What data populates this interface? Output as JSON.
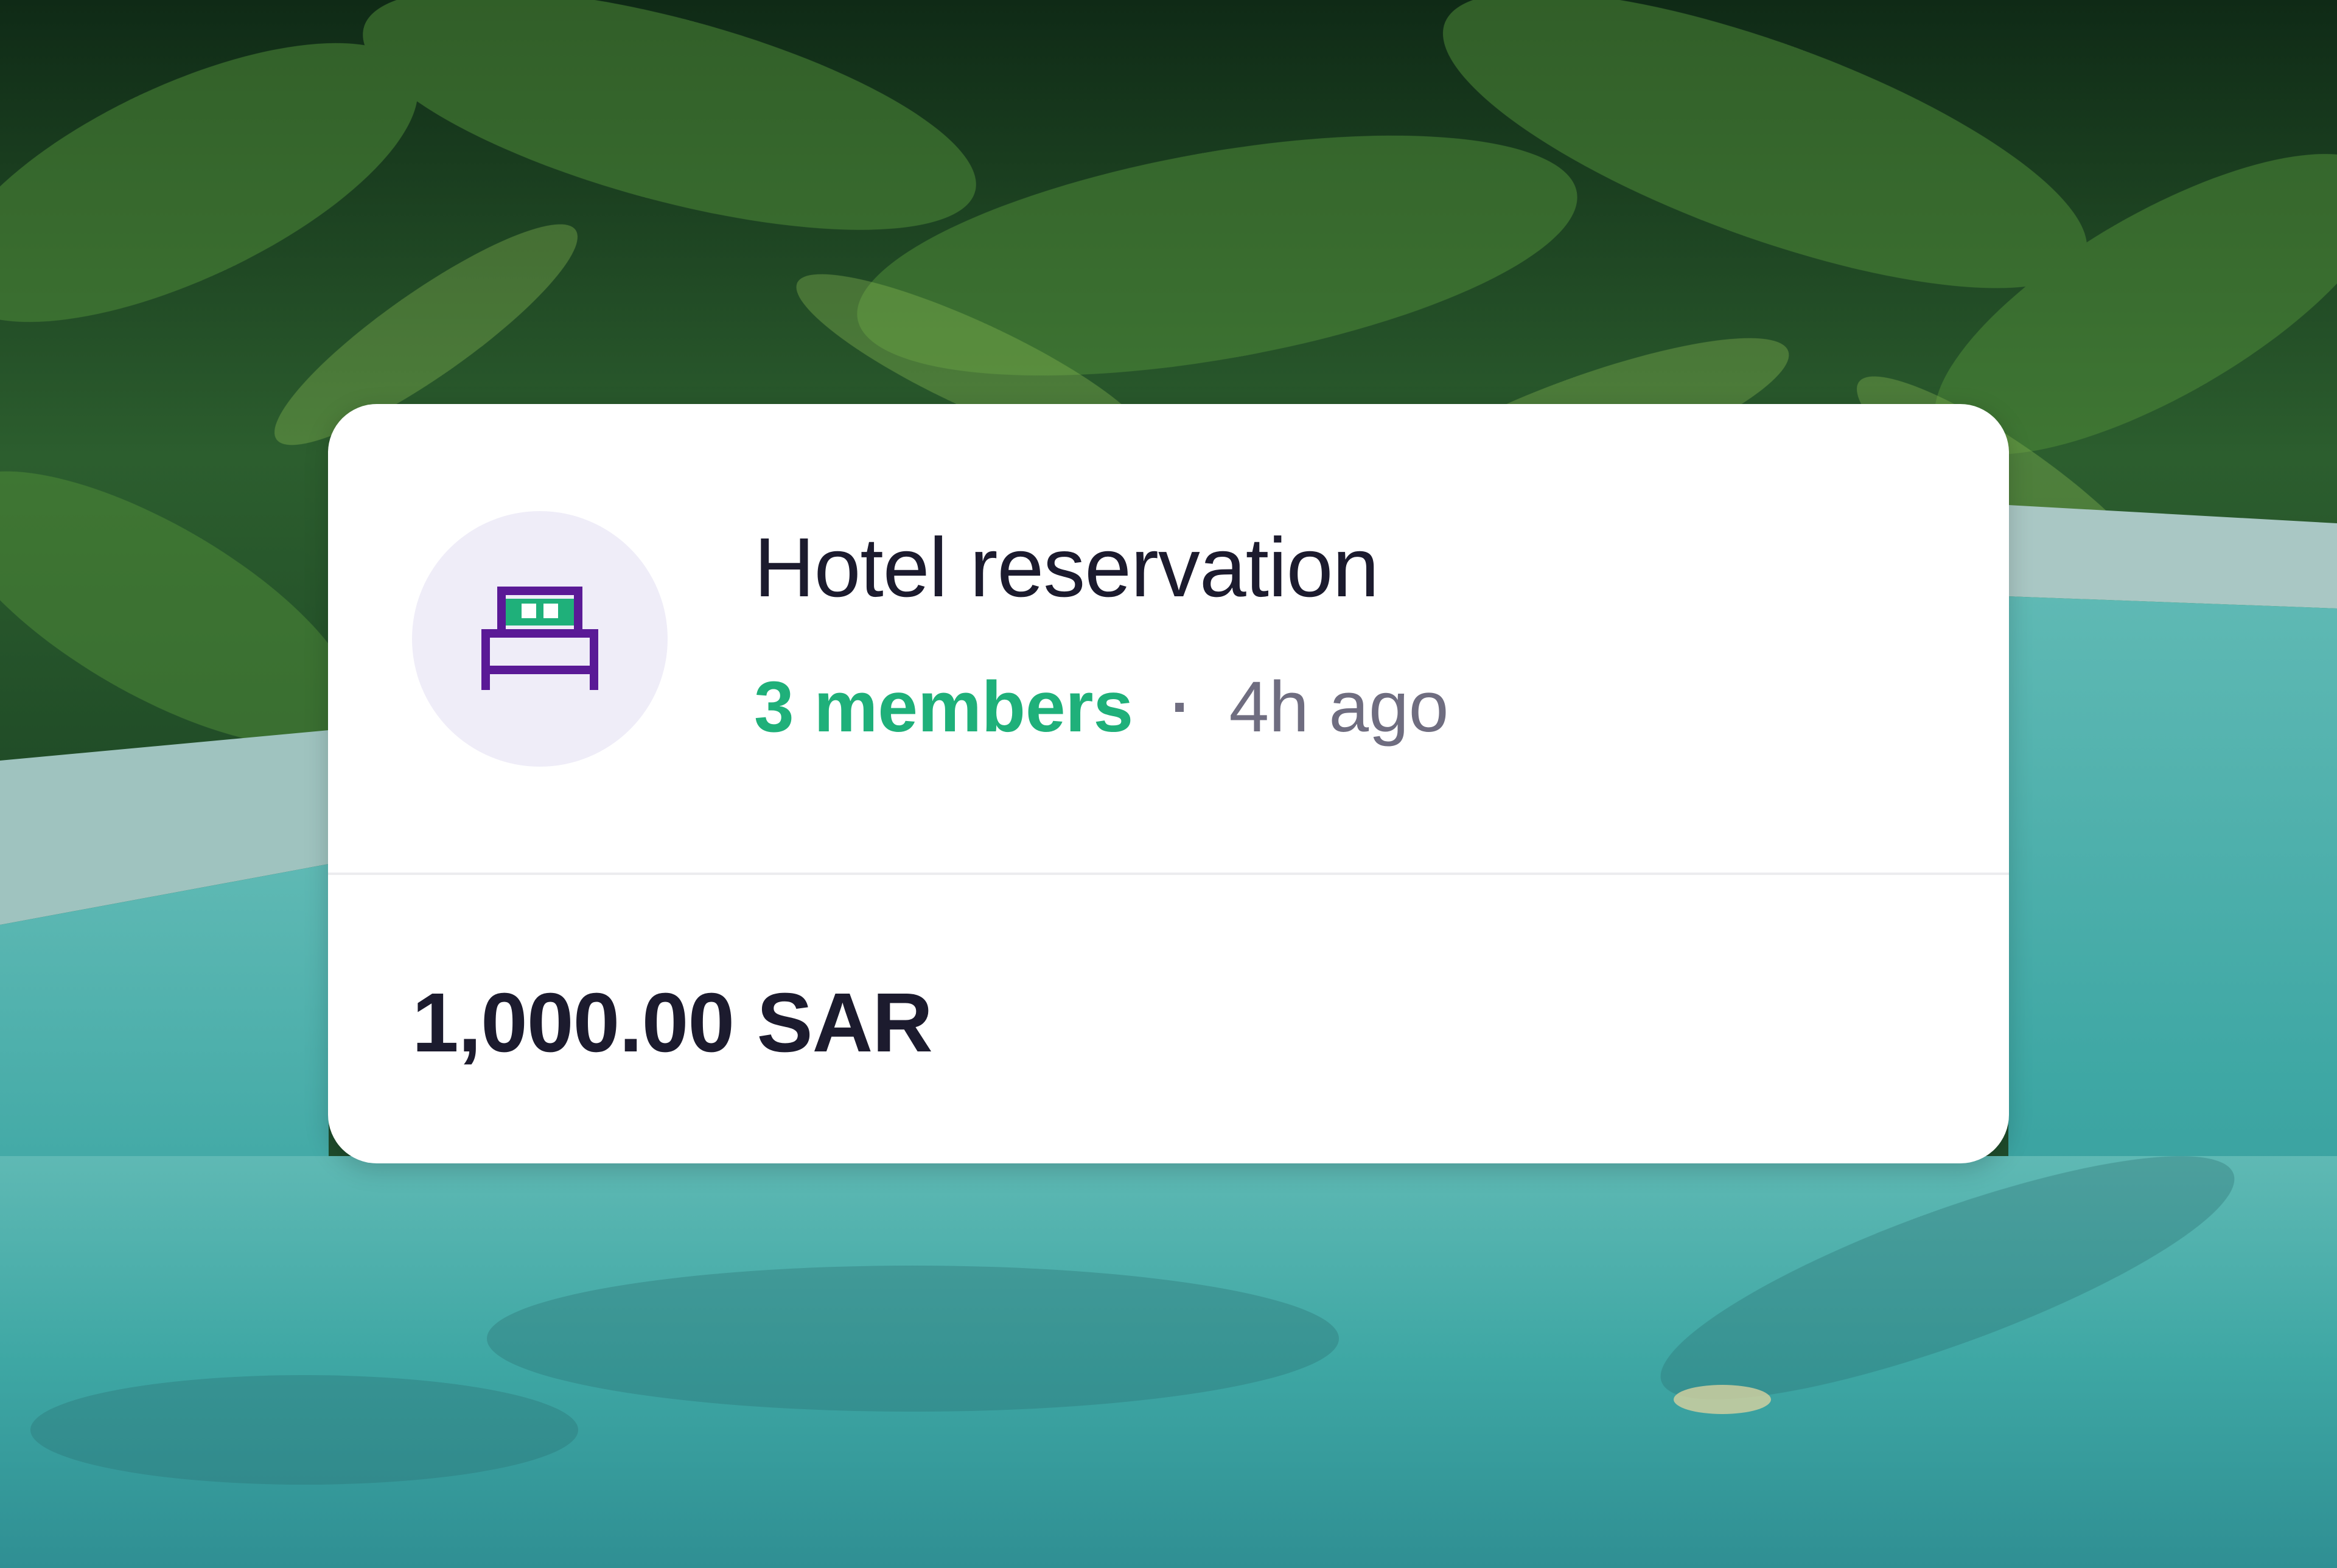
{
  "card": {
    "icon": "bed-icon",
    "title": "Hotel reservation",
    "members": "3 members",
    "separator": "·",
    "time_ago": "4h ago",
    "amount": "1,000.00 SAR"
  },
  "colors": {
    "members_accent": "#1fb07a",
    "icon_bed": "#5a1a96",
    "icon_pillow": "#1fb07a",
    "icon_circle_bg": "#efedf8",
    "title_text": "#1c1b2e",
    "muted_text": "#6f6d80"
  }
}
